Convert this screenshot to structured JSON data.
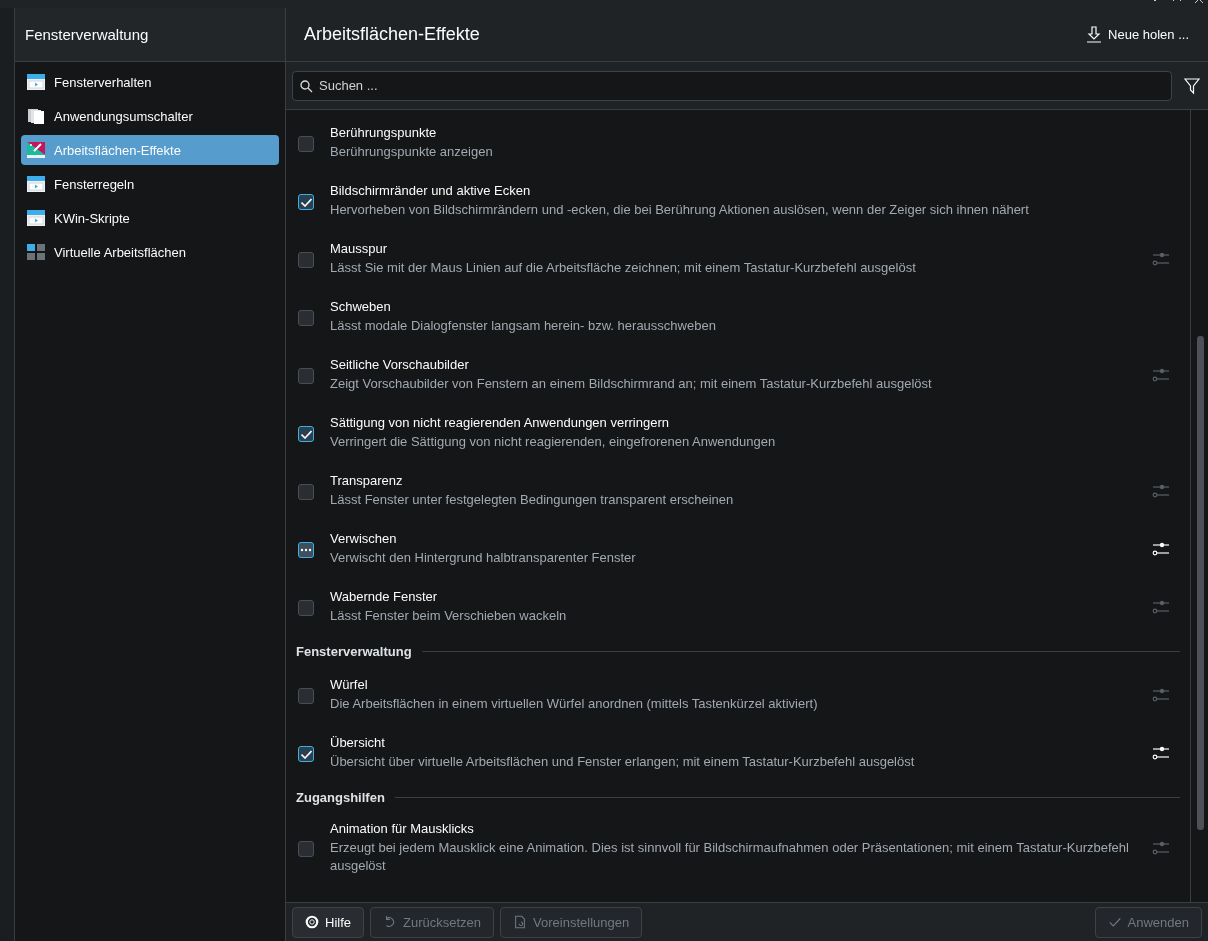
{
  "sidebar": {
    "title": "Fensterverwaltung",
    "items": [
      {
        "label": "Fensterverhalten",
        "selected": false
      },
      {
        "label": "Anwendungsumschalter",
        "selected": false
      },
      {
        "label": "Arbeitsflächen-Effekte",
        "selected": true
      },
      {
        "label": "Fensterregeln",
        "selected": false
      },
      {
        "label": "KWin-Skripte",
        "selected": false
      },
      {
        "label": "Virtuelle Arbeitsflächen",
        "selected": false
      }
    ]
  },
  "header": {
    "title": "Arbeitsflächen-Effekte",
    "get_new_button": "Neue holen ..."
  },
  "search": {
    "placeholder": "Suchen ..."
  },
  "effects": [
    {
      "kind": "effect",
      "name": "Berührungspunkte",
      "description": "Berührungspunkte anzeigen",
      "checked": false,
      "partial": false,
      "has_settings": false
    },
    {
      "kind": "effect",
      "name": "Bildschirmränder und aktive Ecken",
      "description": "Hervorheben von Bildschirmrändern und -ecken, die bei Berührung Aktionen auslösen, wenn der Zeiger sich ihnen nähert",
      "checked": true,
      "partial": false,
      "has_settings": false
    },
    {
      "kind": "effect",
      "name": "Mausspur",
      "description": "Lässt Sie mit der Maus Linien auf die Arbeitsfläche zeichnen; mit einem Tastatur-Kurzbefehl ausgelöst",
      "checked": false,
      "partial": false,
      "has_settings": true,
      "settings_enabled": false
    },
    {
      "kind": "effect",
      "name": "Schweben",
      "description": "Lässt modale Dialogfenster langsam herein- bzw. herausschweben",
      "checked": false,
      "partial": false,
      "has_settings": false
    },
    {
      "kind": "effect",
      "name": "Seitliche Vorschaubilder",
      "description": "Zeigt Vorschaubilder von Fenstern an einem Bildschirmrand an; mit einem Tastatur-Kurzbefehl ausgelöst",
      "checked": false,
      "partial": false,
      "has_settings": true,
      "settings_enabled": false
    },
    {
      "kind": "effect",
      "name": "Sättigung von nicht reagierenden Anwendungen verringern",
      "description": "Verringert die Sättigung von nicht reagierenden, eingefrorenen Anwendungen",
      "checked": true,
      "partial": false,
      "has_settings": false
    },
    {
      "kind": "effect",
      "name": "Transparenz",
      "description": "Lässt Fenster unter festgelegten Bedingungen transparent erscheinen",
      "checked": false,
      "partial": false,
      "has_settings": true,
      "settings_enabled": false
    },
    {
      "kind": "effect",
      "name": "Verwischen",
      "description": "Verwischt den Hintergrund halbtransparenter Fenster",
      "checked": true,
      "partial": true,
      "has_settings": true,
      "settings_enabled": true
    },
    {
      "kind": "effect",
      "name": "Wabernde Fenster",
      "description": "Lässt Fenster beim Verschieben wackeln",
      "checked": false,
      "partial": false,
      "has_settings": true,
      "settings_enabled": false
    },
    {
      "kind": "section",
      "name": "Fensterverwaltung"
    },
    {
      "kind": "effect",
      "name": "Würfel",
      "description": "Die Arbeitsflächen in einem virtuellen Würfel anordnen (mittels Tastenkürzel aktiviert)",
      "checked": false,
      "partial": false,
      "has_settings": true,
      "settings_enabled": false
    },
    {
      "kind": "effect",
      "name": "Übersicht",
      "description": "Übersicht über virtuelle Arbeitsflächen und Fenster erlangen; mit einem Tastatur-Kurzbefehl ausgelöst",
      "checked": true,
      "partial": false,
      "has_settings": true,
      "settings_enabled": true
    },
    {
      "kind": "section",
      "name": "Zugangshilfen"
    },
    {
      "kind": "effect",
      "name": "Animation für Mausklicks",
      "description": "Erzeugt bei jedem Mausklick eine Animation. Dies ist sinnvoll für Bildschirmaufnahmen oder Präsentationen; mit einem Tastatur-Kurzbefehl ausgelöst",
      "checked": false,
      "partial": false,
      "has_settings": true,
      "settings_enabled": false
    }
  ],
  "footer": {
    "buttons": [
      {
        "label": "Hilfe",
        "disabled": false
      },
      {
        "label": "Zurücksetzen",
        "disabled": true
      },
      {
        "label": "Voreinstellungen",
        "disabled": true
      },
      {
        "label": "Anwenden",
        "disabled": true
      }
    ]
  }
}
